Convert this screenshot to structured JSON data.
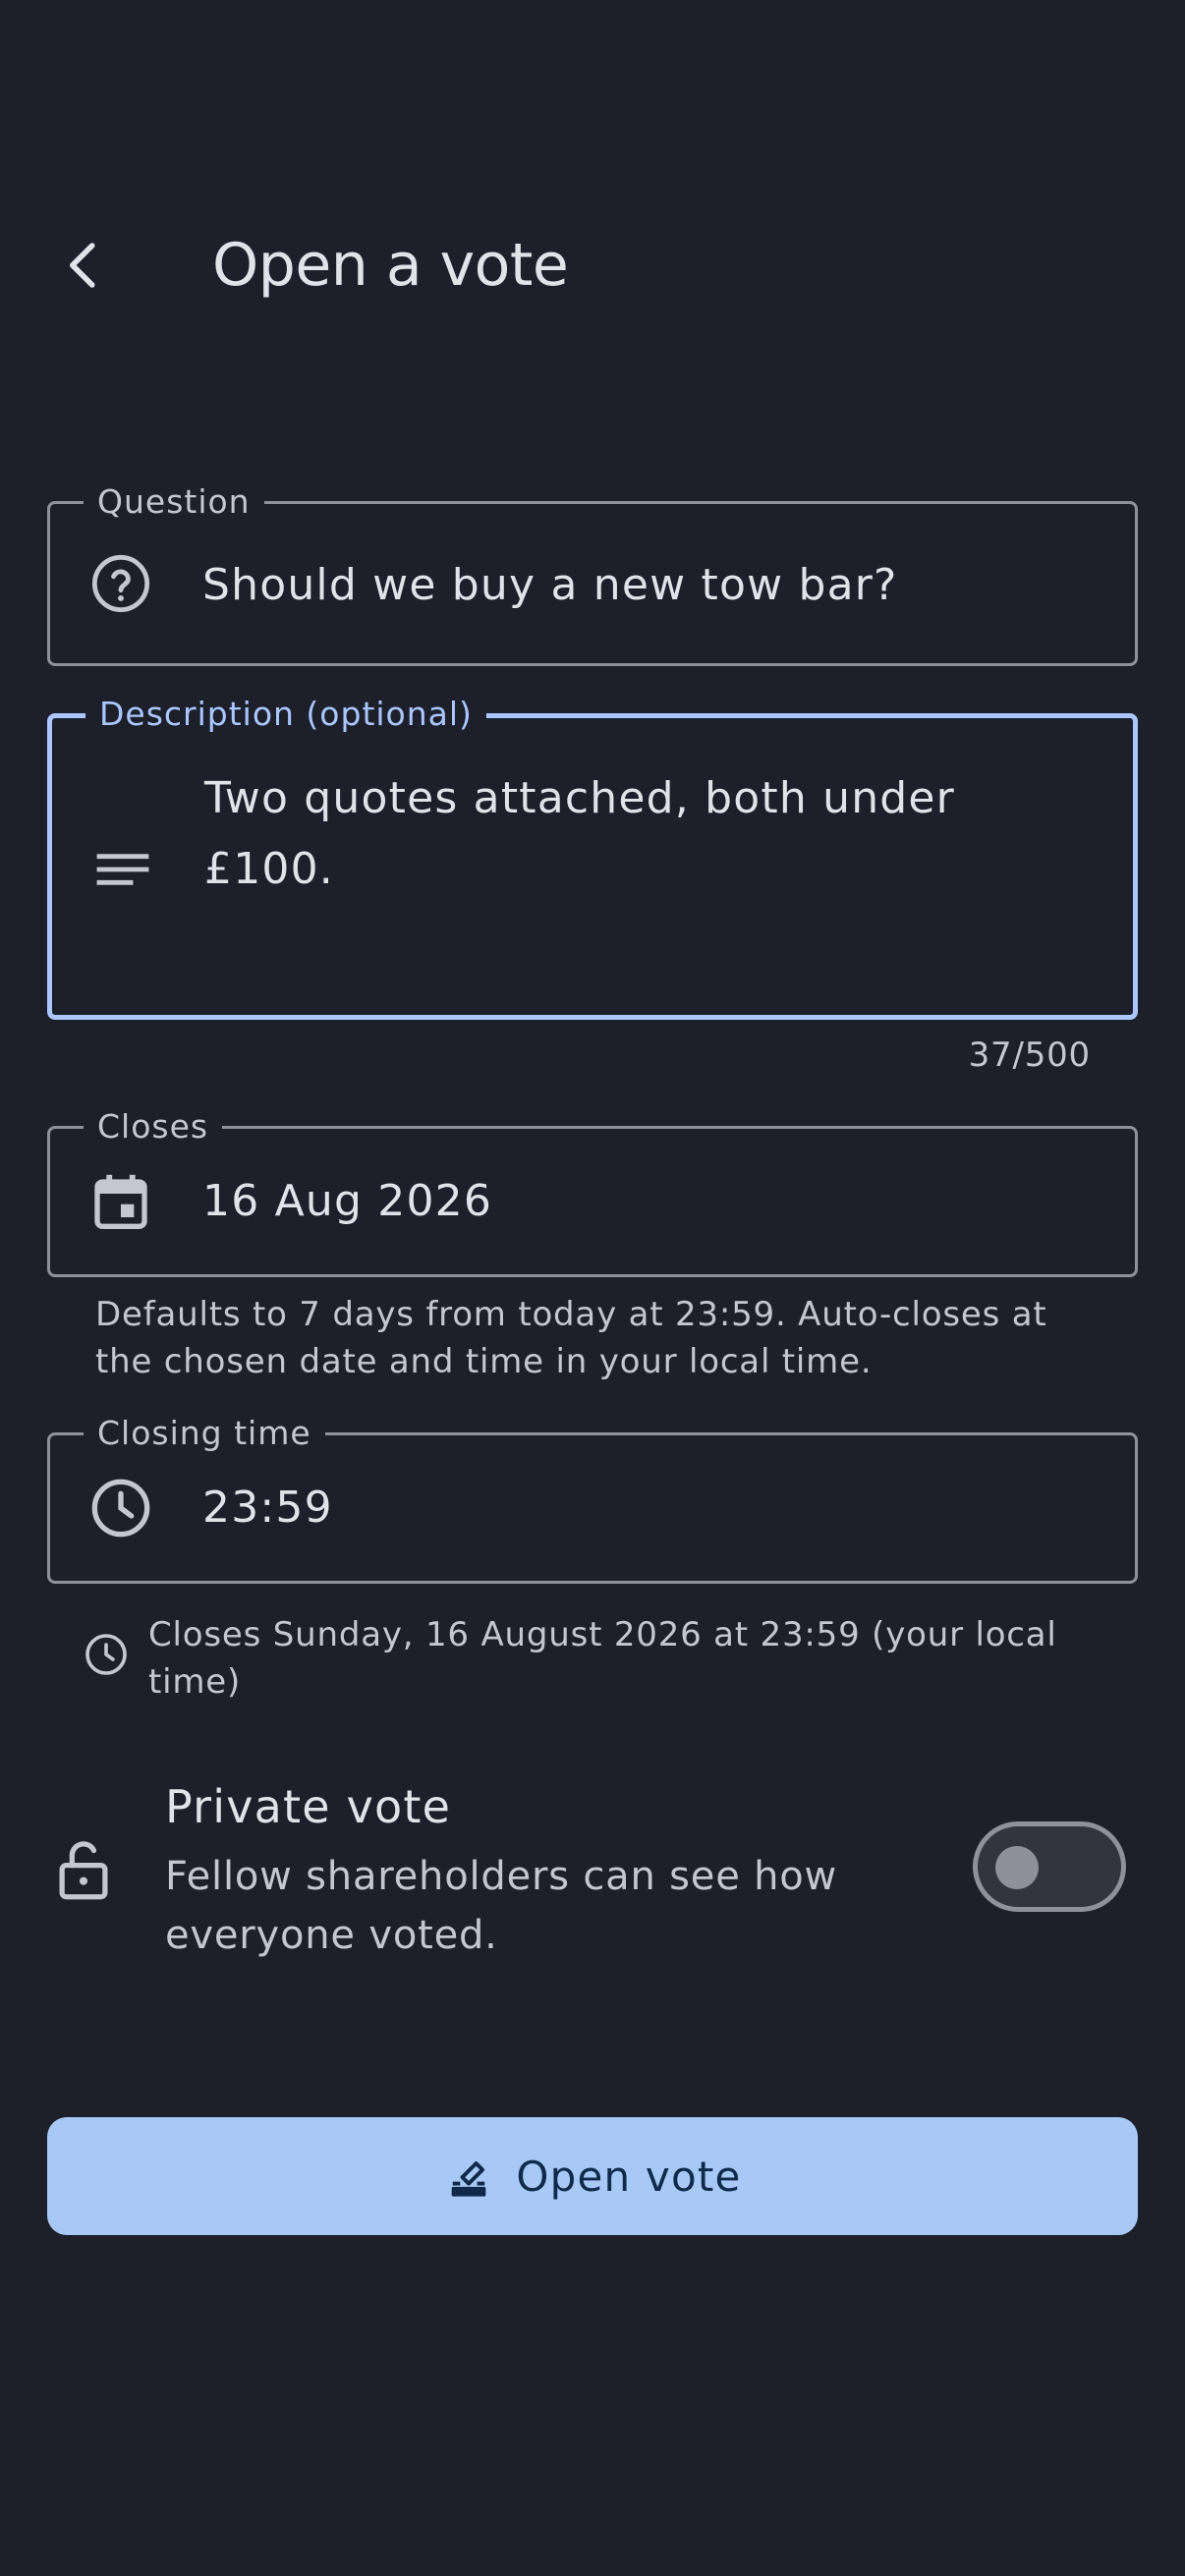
{
  "colors": {
    "background": "#1d202b",
    "outline": "#8f9099",
    "focus": "#aac7ff",
    "primary_container": "#a8c8f5",
    "on_primary_container": "#0f2a4a"
  },
  "header": {
    "back_icon": "chevron-left-icon",
    "title": "Open a vote"
  },
  "form": {
    "question": {
      "label": "Question",
      "icon": "help-circle-icon",
      "value": "Should we buy a new tow bar?"
    },
    "description": {
      "label": "Description (optional)",
      "icon": "notes-icon",
      "value": "Two quotes attached, both under £100.",
      "counter": "37/500"
    },
    "closes": {
      "label": "Closes",
      "icon": "calendar-icon",
      "value": "16 Aug 2026",
      "helper": "Defaults to 7 days from today at 23:59. Auto-closes at the chosen date and time in your local time."
    },
    "closing_time": {
      "label": "Closing time",
      "icon": "clock-icon",
      "value": "23:59"
    },
    "summary": {
      "icon": "clock-icon",
      "text": "Closes Sunday, 16 August 2026 at 23:59 (your local time)"
    },
    "private_vote": {
      "icon": "lock-open-icon",
      "title": "Private vote",
      "subtitle": "Fellow shareholders can see how everyone voted.",
      "enabled": false
    }
  },
  "submit": {
    "icon": "ballot-icon",
    "label": "Open vote"
  }
}
